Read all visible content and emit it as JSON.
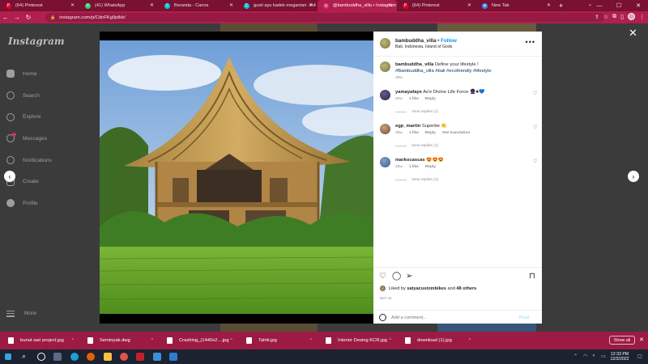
{
  "browser": {
    "tabs": [
      {
        "label": "(64) Pinterest",
        "icon": "pinterest-icon",
        "color": "#e60023",
        "active": false
      },
      {
        "label": "(41) WhatsApp",
        "icon": "whatsapp-icon",
        "color": "#25d366",
        "active": false
      },
      {
        "label": "Beranda - Canva",
        "icon": "canva-icon",
        "color": "#00c4cc",
        "active": false
      },
      {
        "label": "gusti ayu kadek megantari - A4",
        "icon": "canva-icon",
        "color": "#00c4cc",
        "active": false
      },
      {
        "label": "@bambuddha_villa • Instagram",
        "icon": "instagram-icon",
        "color": "#d62976",
        "active": true
      },
      {
        "label": "(64) Pinterest",
        "icon": "pinterest-icon",
        "color": "#e60023",
        "active": false
      },
      {
        "label": "New Tab",
        "icon": "chrome-icon",
        "color": "#4285f4",
        "active": false
      }
    ],
    "url": "instagram.com/p/CdnFKg9ptkb/"
  },
  "instagram": {
    "logo": "Instagram",
    "nav": [
      {
        "label": "Home",
        "icon": "home-icon"
      },
      {
        "label": "Search",
        "icon": "search-icon"
      },
      {
        "label": "Explore",
        "icon": "compass-icon"
      },
      {
        "label": "Messages",
        "icon": "messenger-icon"
      },
      {
        "label": "Notifications",
        "icon": "heart-icon"
      },
      {
        "label": "Create",
        "icon": "plus-square-icon"
      },
      {
        "label": "Profile",
        "icon": "avatar-icon"
      }
    ],
    "more": "More"
  },
  "post": {
    "username": "bambuddha_villa",
    "follow": "Follow",
    "location": "Bali, Indonesia. Island of Gods",
    "caption_text": "Define your lifestyle !",
    "hashtags": "#Bambuddha_villa #bali #ecofriendly #lifestyle",
    "caption_age": "28w",
    "comments": [
      {
        "user": "yamayafaye",
        "text": "As'e Divine Life Force 👩🏿‍🦱♣💙",
        "age": "20w",
        "likes": "1 like",
        "reply": "Reply",
        "translation": "",
        "view_replies": "View replies (1)"
      },
      {
        "user": "egp_martin",
        "text": "Superbe 👏",
        "age": "28w",
        "likes": "1 like",
        "reply": "Reply",
        "translation": "See translation",
        "view_replies": "View replies (1)"
      },
      {
        "user": "markocascas",
        "text": "😍😍😍",
        "age": "28w",
        "likes": "1 like",
        "reply": "Reply",
        "translation": "",
        "view_replies": "View replies (1)"
      }
    ],
    "liked_by_prefix": "Liked by",
    "liked_by_user": "satyacustombikes",
    "liked_by_suffix": "and",
    "liked_by_others": "48 others",
    "date": "MAY 16",
    "comment_placeholder": "Add a comment...",
    "post_button": "Post"
  },
  "downloads": [
    {
      "name": "bunut sari project.jpg"
    },
    {
      "name": "Seminyak.dwg"
    },
    {
      "name": "Crashing_(1440x2....jpg"
    },
    {
      "name": "Tahiti.jpg"
    },
    {
      "name": "Interior Desing KCR.jpg"
    },
    {
      "name": "download (1).jpg"
    }
  ],
  "show_all": "Show all",
  "taskbar": {
    "time": "12:33 PM",
    "date": "12/3/2022"
  }
}
